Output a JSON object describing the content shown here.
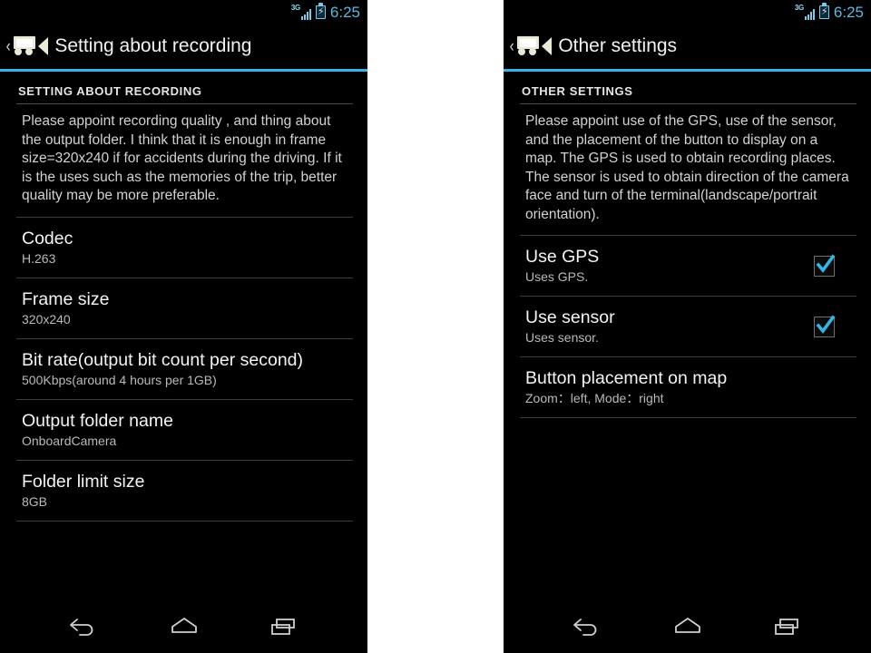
{
  "status_bar": {
    "network_label": "3G",
    "time": "6:25",
    "battery_state": "charging",
    "accent_color": "#33b5e5",
    "clock_color": "#5ab9e0"
  },
  "panels": [
    {
      "action_bar": {
        "back_chevron": "‹",
        "app_icon": "dashcam-icon",
        "title": "Setting about recording"
      },
      "section_header": "SETTING ABOUT RECORDING",
      "intro": "Please appoint recording quality , and thing about the output folder. I think that it is enough in frame size=320x240 if for accidents during the driving. If it is the uses such as the memories of the trip, better quality may be more preferable.",
      "preferences": [
        {
          "title": "Codec",
          "summary": "H.263",
          "has_checkbox": false
        },
        {
          "title": "Frame size",
          "summary": "320x240",
          "has_checkbox": false
        },
        {
          "title": "Bit rate(output bit count per second)",
          "summary": "500Kbps(around 4 hours per 1GB)",
          "has_checkbox": false
        },
        {
          "title": "Output folder name",
          "summary": "OnboardCamera",
          "has_checkbox": false
        },
        {
          "title": "Folder limit size",
          "summary": "8GB",
          "has_checkbox": false
        }
      ]
    },
    {
      "action_bar": {
        "back_chevron": "‹",
        "app_icon": "dashcam-icon",
        "title": "Other settings"
      },
      "section_header": "OTHER SETTINGS",
      "intro": "Please appoint use of the GPS, use of the sensor, and the placement of the button to display on a map. The GPS is used to obtain recording places. The sensor is used to obtain direction of the camera face and turn of the terminal(landscape/portrait orientation).",
      "preferences": [
        {
          "title": "Use GPS",
          "summary": "Uses GPS.",
          "has_checkbox": true,
          "checked": true
        },
        {
          "title": "Use sensor",
          "summary": "Uses sensor.",
          "has_checkbox": true,
          "checked": true
        },
        {
          "title": "Button placement on map",
          "summary": "Zoom：left, Mode：right",
          "has_checkbox": false
        }
      ]
    }
  ],
  "nav_bar": {
    "buttons": [
      {
        "name": "back-icon",
        "label": "Back"
      },
      {
        "name": "home-icon",
        "label": "Home"
      },
      {
        "name": "recents-icon",
        "label": "Recents"
      }
    ]
  },
  "theme": {
    "background": "#000000",
    "divider": "#4a4a4a",
    "title_text": "#f4f4f4",
    "summary_text": "#b9b9b9",
    "checkbox_check": "#33b5e5",
    "icon_cream": "#eae8d6"
  }
}
